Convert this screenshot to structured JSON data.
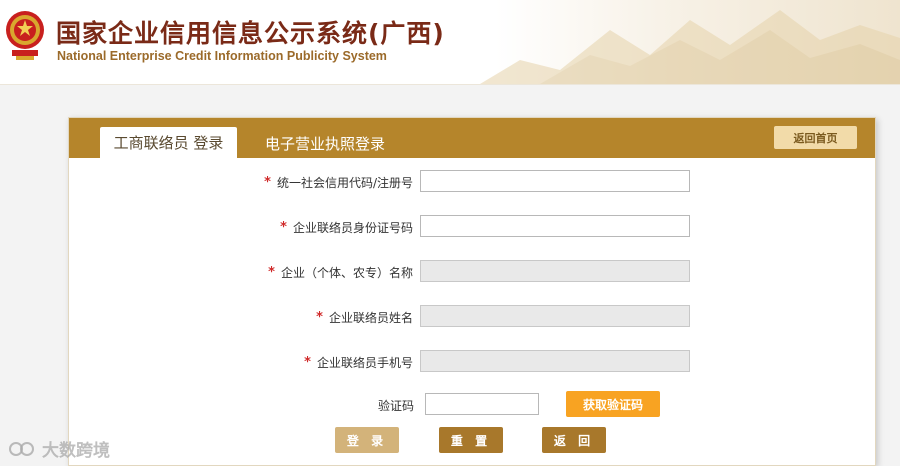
{
  "header": {
    "title": "国家企业信用信息公示系统(广西)",
    "subtitle": "National Enterprise Credit Information Publicity System"
  },
  "tabs": [
    {
      "label": "工商联络员 登录",
      "active": true
    },
    {
      "label": "电子营业执照登录",
      "active": false
    }
  ],
  "return_home": "返回首页",
  "form": {
    "fields": [
      {
        "label": "统一社会信用代码/注册号",
        "required": true,
        "value": "",
        "disabled": false
      },
      {
        "label": "企业联络员身份证号码",
        "required": true,
        "value": "",
        "disabled": false
      },
      {
        "label": "企业（个体、农专）名称",
        "required": true,
        "value": "",
        "disabled": true
      },
      {
        "label": "企业联络员姓名",
        "required": true,
        "value": "",
        "disabled": true
      },
      {
        "label": "企业联络员手机号",
        "required": true,
        "value": "",
        "disabled": true
      }
    ],
    "captcha_label": "验证码",
    "captcha_value": "",
    "get_code_label": "获取验证码",
    "buttons": {
      "login": "登 录",
      "reset": "重 置",
      "back": "返 回"
    }
  },
  "watermark": "大数跨境",
  "colors": {
    "accent": "#b5852b",
    "title": "#7a2a17",
    "required": "#d02a2a",
    "get_code": "#f8a322"
  }
}
